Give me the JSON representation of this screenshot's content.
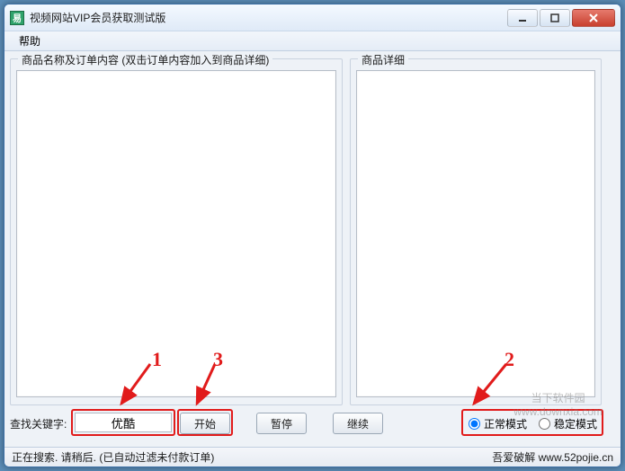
{
  "window": {
    "title": "视频网站VIP会员获取测试版"
  },
  "menu": {
    "help": "帮助"
  },
  "groups": {
    "left_title": "商品名称及订单内容 (双击订单内容加入到商品详细)",
    "right_title": "商品详细"
  },
  "search": {
    "label": "查找关键字:",
    "value": "优酷",
    "start": "开始",
    "pause": "暂停",
    "continue": "继续"
  },
  "mode": {
    "normal": "正常模式",
    "stable": "稳定模式"
  },
  "status": {
    "left": "正在搜索. 请稍后. (已自动过滤未付款订单)",
    "right": "吾爱破解 www.52pojie.cn"
  },
  "annotations": {
    "n1": "1",
    "n2": "2",
    "n3": "3"
  },
  "watermark": {
    "line1": "当下软件园",
    "line2": "www.downxia.com"
  }
}
